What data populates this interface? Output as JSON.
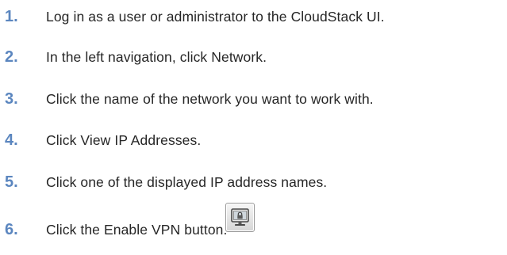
{
  "steps": [
    {
      "number": "1.",
      "text": "Log in as a user or administrator to the CloudStack UI."
    },
    {
      "number": "2.",
      "text": "In the left navigation, click Network."
    },
    {
      "number": "3.",
      "text": "Click the name of the network you want to work with."
    },
    {
      "number": "4.",
      "text": "Click View IP Addresses."
    },
    {
      "number": "5.",
      "text": "Click one of the displayed IP address names."
    },
    {
      "number": "6.",
      "text": "Click the Enable VPN button."
    }
  ],
  "icons": {
    "enable_vpn": "enable-vpn-icon"
  },
  "colors": {
    "step_number": "#5b86bf",
    "step_text": "#262626"
  }
}
